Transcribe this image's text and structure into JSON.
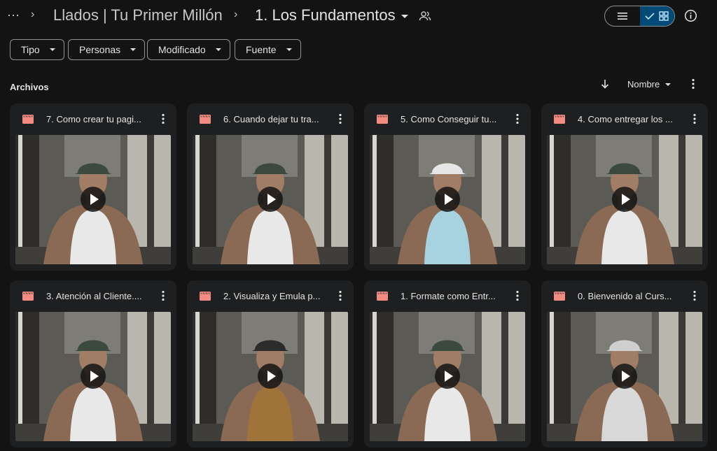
{
  "header": {
    "more_icon": "more-horizontal-icon",
    "breadcrumb": [
      {
        "label": "Llados | Tu Primer Millón"
      },
      {
        "label": "1. Los Fundamentos"
      }
    ],
    "shared_icon": "people-icon",
    "view_list_icon": "list-icon",
    "view_grid_icon": "grid-check-icon",
    "info_icon": "info-icon"
  },
  "filters": [
    {
      "label": "Tipo"
    },
    {
      "label": "Personas"
    },
    {
      "label": "Modificado"
    },
    {
      "label": "Fuente"
    }
  ],
  "section": {
    "title": "Archivos",
    "sort_label": "Nombre",
    "sort_direction_icon": "arrow-down-icon"
  },
  "files": [
    {
      "title": "7. Como crear tu pagi...",
      "type_icon": "video-icon",
      "shirt": "#e8e8e8",
      "cap": "#3b4a3c"
    },
    {
      "title": "6. Cuando dejar tu tra...",
      "type_icon": "video-icon",
      "shirt": "#e8e8e8",
      "cap": "#3b4a3c"
    },
    {
      "title": "5. Como Conseguir tu...",
      "type_icon": "video-icon",
      "shirt": "#a7d3e0",
      "cap": "#e6e6e6"
    },
    {
      "title": "4. Como entregar los ...",
      "type_icon": "video-icon",
      "shirt": "#e8e8e8",
      "cap": "#3b4a3c"
    },
    {
      "title": "3. Atención al Cliente....",
      "type_icon": "video-icon",
      "shirt": "#e8e8e8",
      "cap": "#3b4a3c"
    },
    {
      "title": "2. Visualiza y Emula p...",
      "type_icon": "video-icon",
      "shirt": "#a0733a",
      "cap": "#2b2b2b"
    },
    {
      "title": "1. Formate como Entr...",
      "type_icon": "video-icon",
      "shirt": "#e8e8e8",
      "cap": "#3b4a3c"
    },
    {
      "title": "0. Bienvenido al Curs...",
      "type_icon": "video-icon",
      "shirt": "#d9d9d9",
      "cap": "#cfcfcf"
    }
  ],
  "colors": {
    "background": "#131314",
    "card": "#1e1f20",
    "video_icon": "#f28b82",
    "active_toggle": "#004a77"
  }
}
